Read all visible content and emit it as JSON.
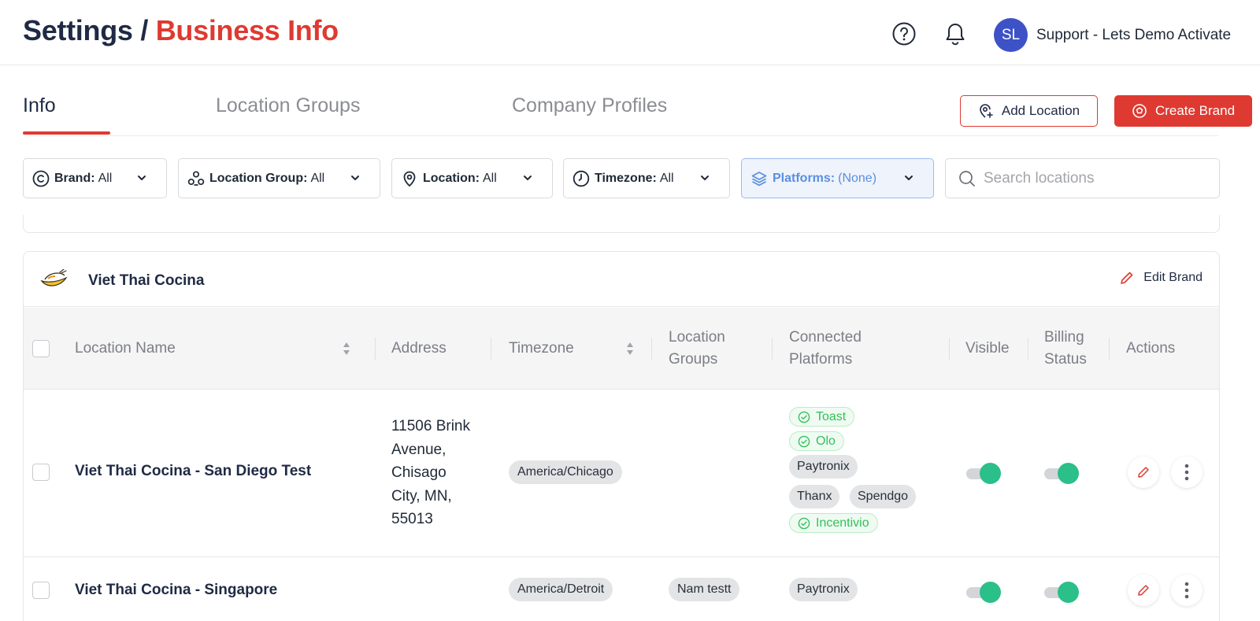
{
  "breadcrumb": {
    "root": "Settings",
    "separator": " / ",
    "current": "Business Info"
  },
  "header": {
    "help_icon": "question-circle-icon",
    "notifications_icon": "bell-icon",
    "avatar_initials": "SL",
    "user_name": "Support - Lets Demo Activate"
  },
  "tabs": [
    {
      "label": "Info",
      "active": true
    },
    {
      "label": "Location Groups",
      "active": false
    },
    {
      "label": "Company Profiles",
      "active": false
    }
  ],
  "actions": {
    "add_location": "Add Location",
    "create_brand": "Create Brand"
  },
  "filters": {
    "brand": {
      "label": "Brand:",
      "value": "All"
    },
    "location_group": {
      "label": "Location Group:",
      "value": "All"
    },
    "location": {
      "label": "Location:",
      "value": "All"
    },
    "timezone": {
      "label": "Timezone:",
      "value": "All"
    },
    "platforms": {
      "label": "Platforms:",
      "value": "(None)"
    }
  },
  "search": {
    "placeholder": "Search locations",
    "value": ""
  },
  "brand": {
    "name": "Viet Thai Cocina",
    "edit_label": "Edit Brand"
  },
  "table": {
    "columns": {
      "location_name": "Location Name",
      "address": "Address",
      "timezone": "Timezone",
      "location_groups_1": "Location",
      "location_groups_2": "Groups",
      "connected_platforms_1": "Connected",
      "connected_platforms_2": "Platforms",
      "visible": "Visible",
      "billing_status_1": "Billing",
      "billing_status_2": "Status",
      "actions": "Actions"
    },
    "rows": [
      {
        "name": "Viet Thai Cocina - San Diego Test",
        "address": "11506 Brink\nAvenue,\nChisago\nCity, MN,\n55013",
        "timezone": "America/Chicago",
        "location_group": "",
        "platforms": [
          {
            "name": "Toast",
            "connected": true
          },
          {
            "name": "Olo",
            "connected": true
          },
          {
            "name": "Paytronix",
            "connected": false
          },
          {
            "name": "Thanx",
            "connected": false
          },
          {
            "name": "Spendgo",
            "connected": false
          },
          {
            "name": "Incentivio",
            "connected": true
          }
        ],
        "visible": true,
        "billing_active": true
      },
      {
        "name": "Viet Thai Cocina - Singapore",
        "address": "",
        "timezone": "America/Detroit",
        "location_group": "Nam testt",
        "platforms": [
          {
            "name": "Paytronix",
            "connected": false
          }
        ],
        "visible": true,
        "billing_active": true
      }
    ]
  },
  "colors": {
    "accent_red": "#de3a31",
    "title_navy": "#1f2a44",
    "toggle_on": "#2bbf8a",
    "avatar_blue": "#3d52c7",
    "connected_green": "#31c257",
    "platforms_filter_blue": "#5a8fe0"
  }
}
